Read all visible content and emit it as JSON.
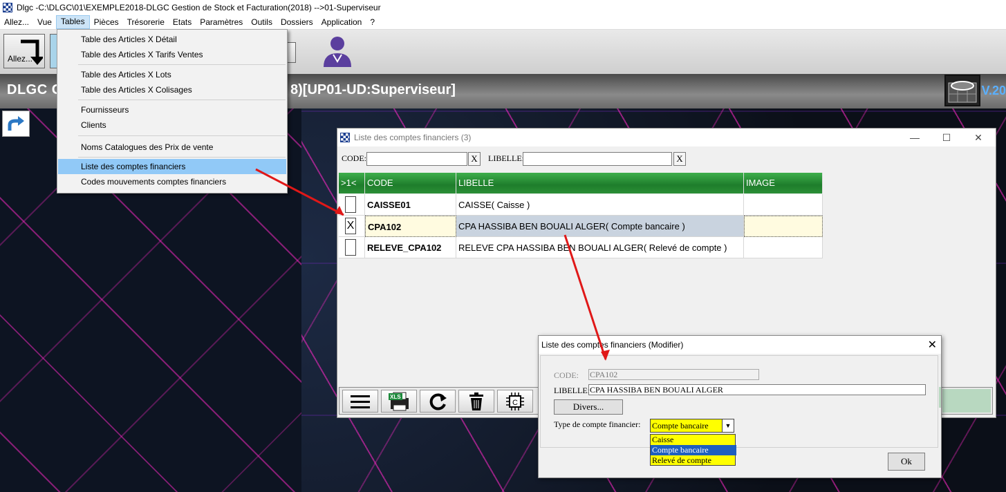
{
  "window": {
    "title": "Dlgc -C:\\DLGC\\01\\EXEMPLE2018-DLGC Gestion de Stock et Facturation(2018) -->01-Superviseur"
  },
  "menubar": {
    "items": [
      "Allez...",
      "Vue",
      "Tables",
      "Pièces",
      "Trésorerie",
      "Etats",
      "Paramètres",
      "Outils",
      "Dossiers",
      "Application",
      "?"
    ],
    "active": "Tables"
  },
  "toolbar": {
    "allez_label": "Allez..."
  },
  "header": {
    "title_left": "DLGC G",
    "title_right": "8)[UP01-UD:Superviseur]",
    "version": "V.20"
  },
  "tables_menu": {
    "items": [
      "Table des Articles X Détail",
      "Table des Articles X Tarifs Ventes",
      "Table des Articles X Lots",
      "Table des Articles X Colisages",
      "Fournisseurs",
      "Clients",
      "Noms Catalogues des Prix de vente",
      "Liste des comptes financiers",
      "Codes mouvements comptes financiers"
    ],
    "highlighted": "Liste des comptes financiers"
  },
  "list_window": {
    "title": "Liste des comptes financiers (3)",
    "filters": {
      "code_label": "CODE:",
      "libelle_label": "LIBELLE:",
      "code_value": "",
      "libelle_value": "",
      "clear_label": "X"
    },
    "columns": [
      ">1<",
      "CODE",
      "LIBELLE",
      "IMAGE"
    ],
    "rows": [
      {
        "checked": "",
        "code": "CAISSE01",
        "libelle": "CAISSE( Caisse )",
        "image": ""
      },
      {
        "checked": "X",
        "code": "CPA102",
        "libelle": "CPA HASSIBA BEN BOUALI ALGER( Compte bancaire )",
        "image": ""
      },
      {
        "checked": "",
        "code": "RELEVE_CPA102",
        "libelle": "RELEVE CPA HASSIBA BEN BOUALI ALGER( Relevé de compte )",
        "image": ""
      }
    ],
    "bottom_tools": [
      "menu-icon",
      "xls-print-icon",
      "refresh-icon",
      "trash-icon",
      "calculator-icon"
    ]
  },
  "modify_dialog": {
    "title": "Liste des comptes financiers  (Modifier)",
    "code_label": "CODE:",
    "code_value": "CPA102",
    "libelle_label": "LIBELLE:",
    "libelle_value": "CPA HASSIBA BEN BOUALI ALGER",
    "divers_label": "Divers...",
    "type_label": "Type de compte financier:",
    "type_value": "Compte bancaire",
    "type_options": [
      "Caisse",
      "Compte bancaire",
      "Relevé de compte"
    ],
    "ok_label": "Ok"
  },
  "colors": {
    "grid_header": "#2a8f36",
    "selection": "#c9d3df",
    "combo": "#ffff00",
    "annotation_arrow": "#e01818"
  }
}
